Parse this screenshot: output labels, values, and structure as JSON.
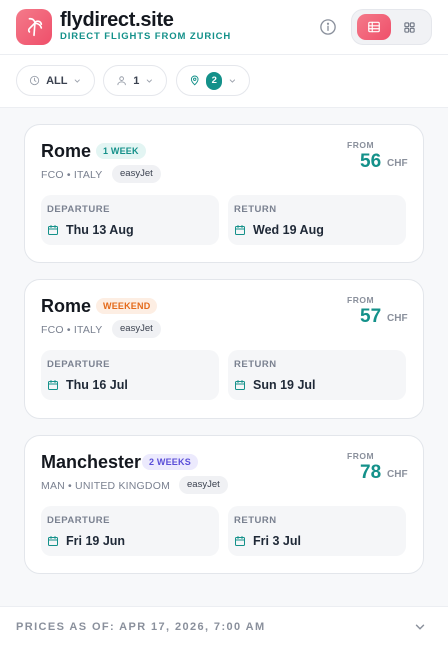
{
  "header": {
    "title": "flydirect.site",
    "subtitle": "DIRECT FLIGHTS FROM ZURICH"
  },
  "filters": {
    "time": "ALL",
    "passengers": "1",
    "destinations_count": "2"
  },
  "cards": [
    {
      "city": "Rome",
      "duration": "1 WEEK",
      "location": "FCO • ITALY",
      "airline": "easyJet",
      "price_from": "FROM",
      "price": "56",
      "currency": "CHF",
      "departure_label": "DEPARTURE",
      "departure": "Thu 13 Aug",
      "return_label": "RETURN",
      "return": "Wed 19 Aug"
    },
    {
      "city": "Rome",
      "duration": "WEEKEND",
      "location": "FCO • ITALY",
      "airline": "easyJet",
      "price_from": "FROM",
      "price": "57",
      "currency": "CHF",
      "departure_label": "DEPARTURE",
      "departure": "Thu 16 Jul",
      "return_label": "RETURN",
      "return": "Sun 19 Jul"
    },
    {
      "city": "Manchester",
      "duration": "2 WEEKS",
      "location": "MAN • UNITED KINGDOM",
      "airline": "easyJet",
      "price_from": "FROM",
      "price": "78",
      "currency": "CHF",
      "departure_label": "DEPARTURE",
      "departure": "Fri 19 Jun",
      "return_label": "RETURN",
      "return": "Fri 3 Jul"
    }
  ],
  "footer": {
    "prices_as_of": "PRICES AS OF: APR 17, 2026, 7:00 AM"
  },
  "colors": {
    "brand": "#ef4f6a",
    "accent": "#14918a"
  }
}
